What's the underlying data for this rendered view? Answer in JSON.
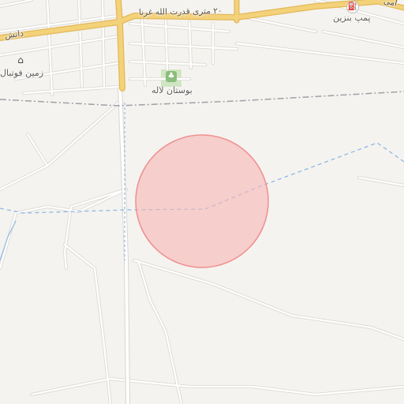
{
  "map": {
    "labels": {
      "road_main": "۲۰ متری قدرت الله غرنا",
      "road_left": "دانش",
      "park": "بوستان لاله",
      "fuel": "پمپ بنزین",
      "football": "زمین فوتبال",
      "top_right_fragment": "امی"
    },
    "colors": {
      "background": "#f5f3ef",
      "major_road": "#f3d27a",
      "major_road_casing": "#e2b85a",
      "minor_road": "#ffffff",
      "minor_road_casing": "#d9d6d0",
      "waterway": "#9ec2ea",
      "boundary": "#a39ea8",
      "highlight_fill": "#f7b6b6",
      "highlight_stroke": "#ef8f8f",
      "park_green": "#cfe6c2"
    },
    "icons": {
      "park": "tree-icon",
      "fuel": "fuel-pump-icon",
      "football": "stadium-icon"
    }
  }
}
